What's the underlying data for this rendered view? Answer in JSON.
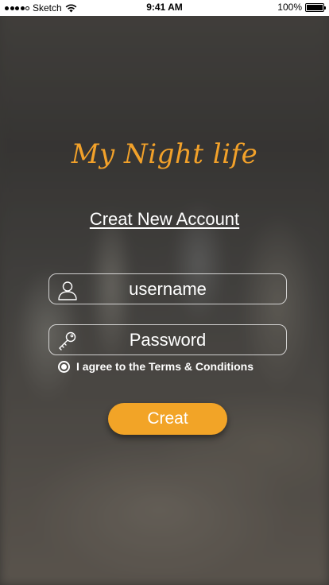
{
  "status_bar": {
    "carrier": "Sketch",
    "time": "9:41 AM",
    "battery": "100%",
    "signal_bars": 5,
    "icons": [
      "signal-icon",
      "wifi-icon",
      "battery-icon"
    ]
  },
  "brand": {
    "title": "My Night life",
    "color": "#f2a12a"
  },
  "heading": "Creat New Account",
  "form": {
    "username": {
      "placeholder": "username",
      "value": "",
      "icon": "user-icon"
    },
    "password": {
      "placeholder": "Password",
      "value": "",
      "icon": "key-icon"
    },
    "terms": {
      "label": "I agree to the Terms & Conditions",
      "checked": true
    },
    "submit_label": "Creat"
  },
  "colors": {
    "accent": "#f2a427",
    "text": "#ffffff"
  }
}
